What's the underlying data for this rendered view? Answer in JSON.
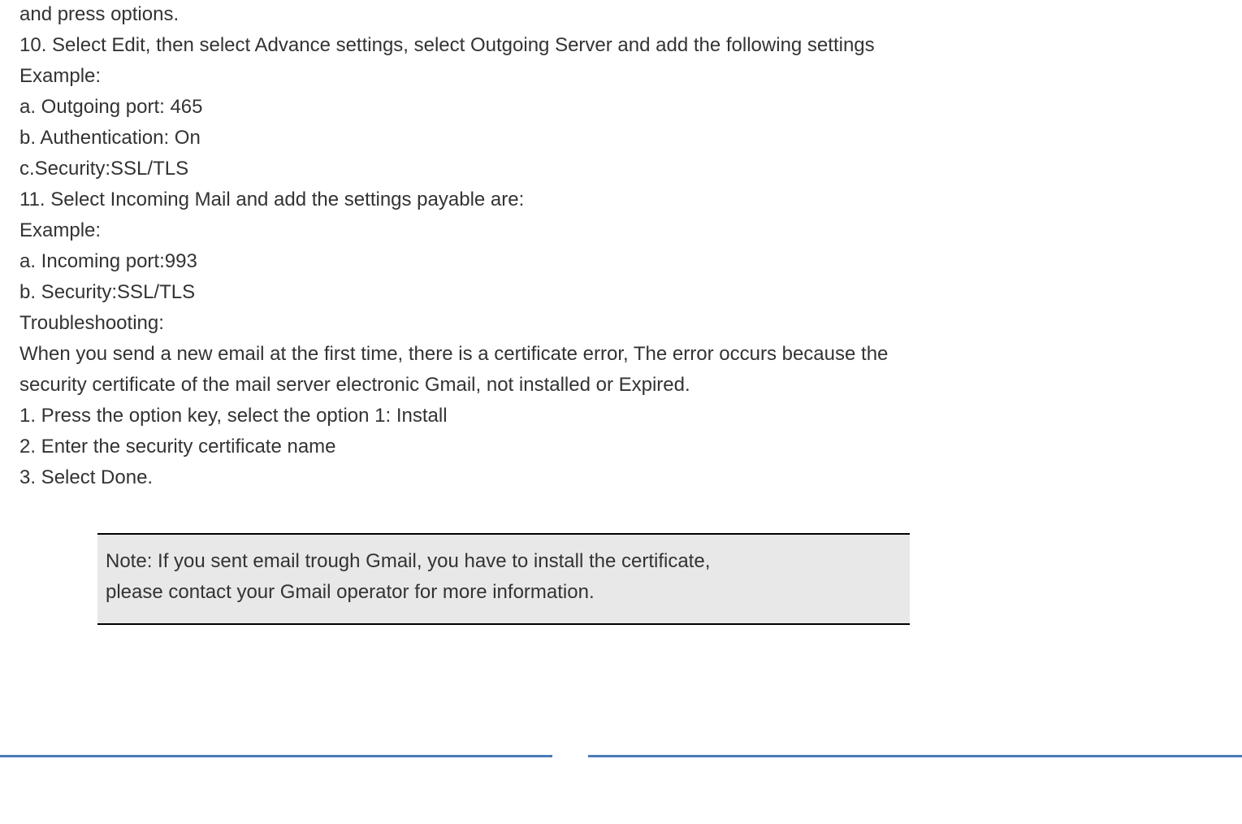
{
  "lines": {
    "l1": "and press options.",
    "l2": "10.      Select Edit, then select Advance settings, select Outgoing Server and add the following settings",
    "l3": "Example:",
    "l4": "a. Outgoing port: 465",
    "l5": "b. Authentication: On",
    "l6": "c.Security:SSL/TLS",
    "l7": "11.      Select Incoming Mail and add the settings payable are:",
    "l8": "Example:",
    "l9": "a.    Incoming port:993",
    "l10": "b.   Security:SSL/TLS",
    "l11": "Troubleshooting:",
    "l12": "When you send a new email at the first time, there is a certificate error, The error occurs because the",
    "l13": "security certificate of the mail server electronic Gmail, not installed or Expired.",
    "l14": "1.       Press the option key, select the option 1: Install",
    "l15": "2.       Enter the security certificate name",
    "l16": "3.       Select Done."
  },
  "note": {
    "line1": "Note: If you sent email trough Gmail, you have to install the certificate,",
    "line2": "please contact your Gmail operator for more information."
  }
}
